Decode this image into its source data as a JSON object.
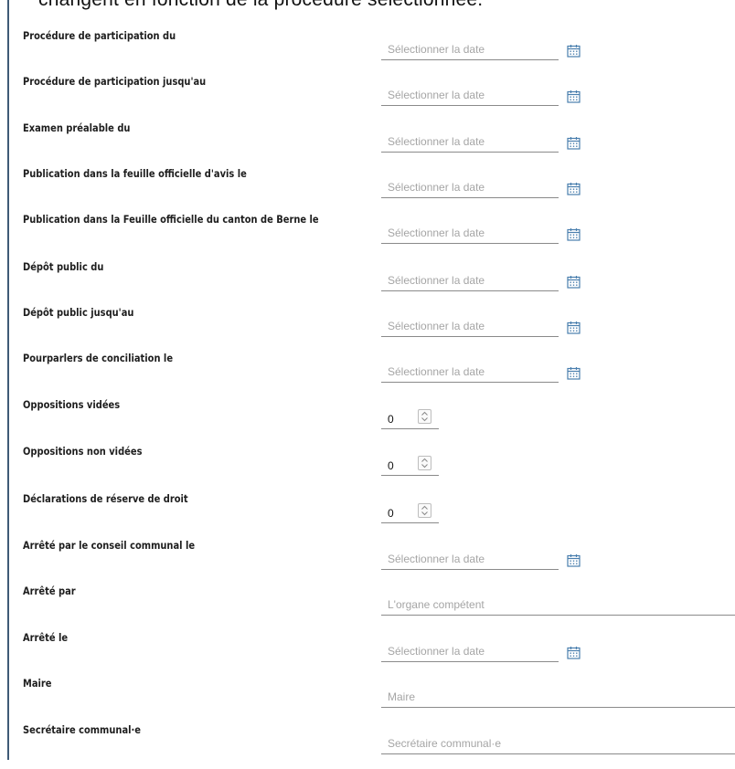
{
  "header": {
    "clipped_text": "changent en fonction de la procédure sélectionnée."
  },
  "fields": [
    {
      "label": "Procédure de participation du",
      "type": "date",
      "placeholder": "Sélectionner la date",
      "icon": "calendar-icon"
    },
    {
      "label": "Procédure de participation jusqu'au",
      "type": "date",
      "placeholder": "Sélectionner la date",
      "icon": "calendar-icon"
    },
    {
      "label": "Examen préalable du",
      "type": "date",
      "placeholder": "Sélectionner la date",
      "icon": "calendar-icon"
    },
    {
      "label": "Publication dans la feuille officielle d'avis le",
      "type": "date",
      "placeholder": "Sélectionner la date",
      "icon": "calendar-icon"
    },
    {
      "label": "Publication dans la Feuille officielle du canton de Berne le",
      "type": "date",
      "placeholder": "Sélectionner la date",
      "icon": "calendar-icon"
    },
    {
      "label": "Dépôt public du",
      "type": "date",
      "placeholder": "Sélectionner la date",
      "icon": "calendar-icon"
    },
    {
      "label": "Dépôt public jusqu'au",
      "type": "date",
      "placeholder": "Sélectionner la date",
      "icon": "calendar-icon"
    },
    {
      "label": "Pourparlers de conciliation le",
      "type": "date",
      "placeholder": "Sélectionner la date",
      "icon": "calendar-icon"
    },
    {
      "label": "Oppositions vidées",
      "type": "number",
      "value": "0",
      "icon": "spinner-icon"
    },
    {
      "label": "Oppositions non vidées",
      "type": "number",
      "value": "0",
      "icon": "spinner-icon"
    },
    {
      "label": "Déclarations de réserve de droit",
      "type": "number",
      "value": "0",
      "icon": "spinner-icon"
    },
    {
      "label": "Arrêté par le conseil communal le",
      "type": "date",
      "placeholder": "Sélectionner la date",
      "icon": "calendar-icon"
    },
    {
      "label": "Arrêté par",
      "type": "text",
      "placeholder": "L'organe compétent"
    },
    {
      "label": "Arrêté le",
      "type": "date",
      "placeholder": "Sélectionner la date",
      "icon": "calendar-icon"
    },
    {
      "label": "Maire",
      "type": "text",
      "placeholder": "Maire"
    },
    {
      "label": "Secrétaire communal·e",
      "type": "text",
      "placeholder": "Secrétaire communal·e"
    }
  ],
  "colors": {
    "accent_line": "#3e5a76",
    "calendar_icon": "#4a7fae",
    "placeholder": "#a5a5a5",
    "underline": "#8a8a8a"
  }
}
